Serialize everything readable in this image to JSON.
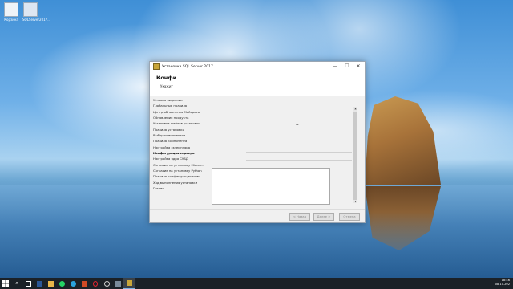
{
  "desktop": {
    "icons": [
      {
        "label": "Корзина",
        "icon": "recycle-bin-icon"
      },
      {
        "label": "SQLServer2017...",
        "icon": "installer-icon"
      }
    ]
  },
  "window": {
    "title": "Установка SQL Server 2017",
    "header_title": "Конфи",
    "header_subtitle": "Укажит",
    "minimize": "—",
    "maximize": "☐",
    "close": "✕",
    "steps": [
      {
        "label": "Условия лицензии",
        "active": false
      },
      {
        "label": "Глобальные правила",
        "active": false
      },
      {
        "label": "Центр обновления Майкросо",
        "active": false
      },
      {
        "label": "Обновления продукта",
        "active": false
      },
      {
        "label": "Установка файлов установки",
        "active": false
      },
      {
        "label": "Правила установки",
        "active": false
      },
      {
        "label": "Выбор компонентов",
        "active": false
      },
      {
        "label": "Правила компонента",
        "active": false
      },
      {
        "label": "Настройка экземпляра",
        "active": false
      },
      {
        "label": "Конфигурация сервера",
        "active": true
      },
      {
        "label": "Настройка ядра СУБД",
        "active": false
      },
      {
        "label": "Согласие на установку Micros...",
        "active": false
      },
      {
        "label": "Согласие на установку Python",
        "active": false
      },
      {
        "label": "Правила конфигурации комп...",
        "active": false
      },
      {
        "label": "Ход выполнения установки",
        "active": false
      },
      {
        "label": "Готово",
        "active": false
      }
    ],
    "buttons": {
      "back": "< Назад",
      "next": "Далее >",
      "cancel": "Отмена"
    }
  },
  "taskbar": {
    "time": "18:46",
    "date": "08.10.202"
  }
}
